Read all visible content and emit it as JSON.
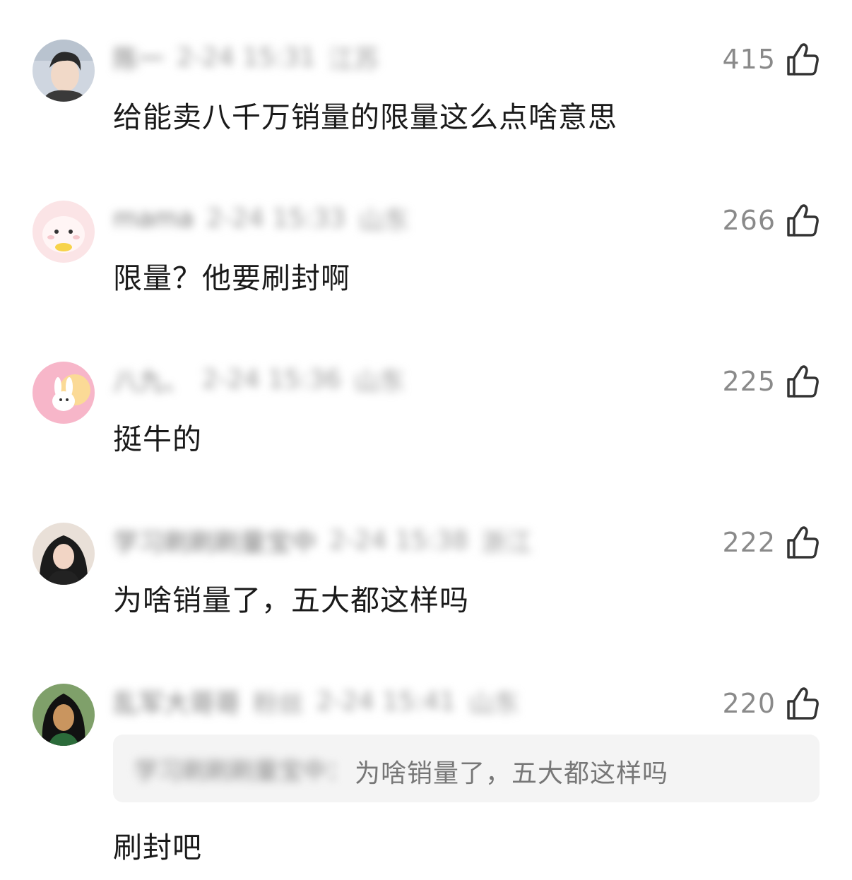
{
  "comments": [
    {
      "name": "陈一",
      "time": "2-24 15:31",
      "location": "江苏",
      "likes": "415",
      "text": "给能卖八千万销量的限量这么点啥意思",
      "avatar_colors": [
        "#cfd6e0",
        "#2a2a2a",
        "#f1d9c8"
      ]
    },
    {
      "name": "mama",
      "time": "2-24 15:33",
      "location": "山东",
      "likes": "266",
      "text": "限量？他要刷封啊",
      "avatar_colors": [
        "#fbe4e6",
        "#f6c8cd",
        "#f7d34a"
      ]
    },
    {
      "name": "八九、",
      "time": "2-24 15:36",
      "location": "山东",
      "likes": "225",
      "text": "挺牛的",
      "avatar_colors": [
        "#f7b6c9",
        "#fbe38a",
        "#ffffff"
      ]
    },
    {
      "name": "学习刷刷刷量宝中",
      "time": "2-24 15:38",
      "location": "浙江",
      "likes": "222",
      "text": "为啥销量了，五大都这样吗",
      "avatar_colors": [
        "#e9e0d8",
        "#1b1b1b",
        "#f2d5c5"
      ]
    },
    {
      "name": "乱军大哥哥",
      "badge": "粉丝",
      "time": "2-24 15:41",
      "location": "山东",
      "likes": "220",
      "quote_name": "学习刷刷刷量宝中：",
      "quote_text": "为啥销量了，五大都这样吗",
      "text": "刷封吧",
      "avatar_colors": [
        "#7fa06a",
        "#111111",
        "#c9955f"
      ]
    }
  ]
}
